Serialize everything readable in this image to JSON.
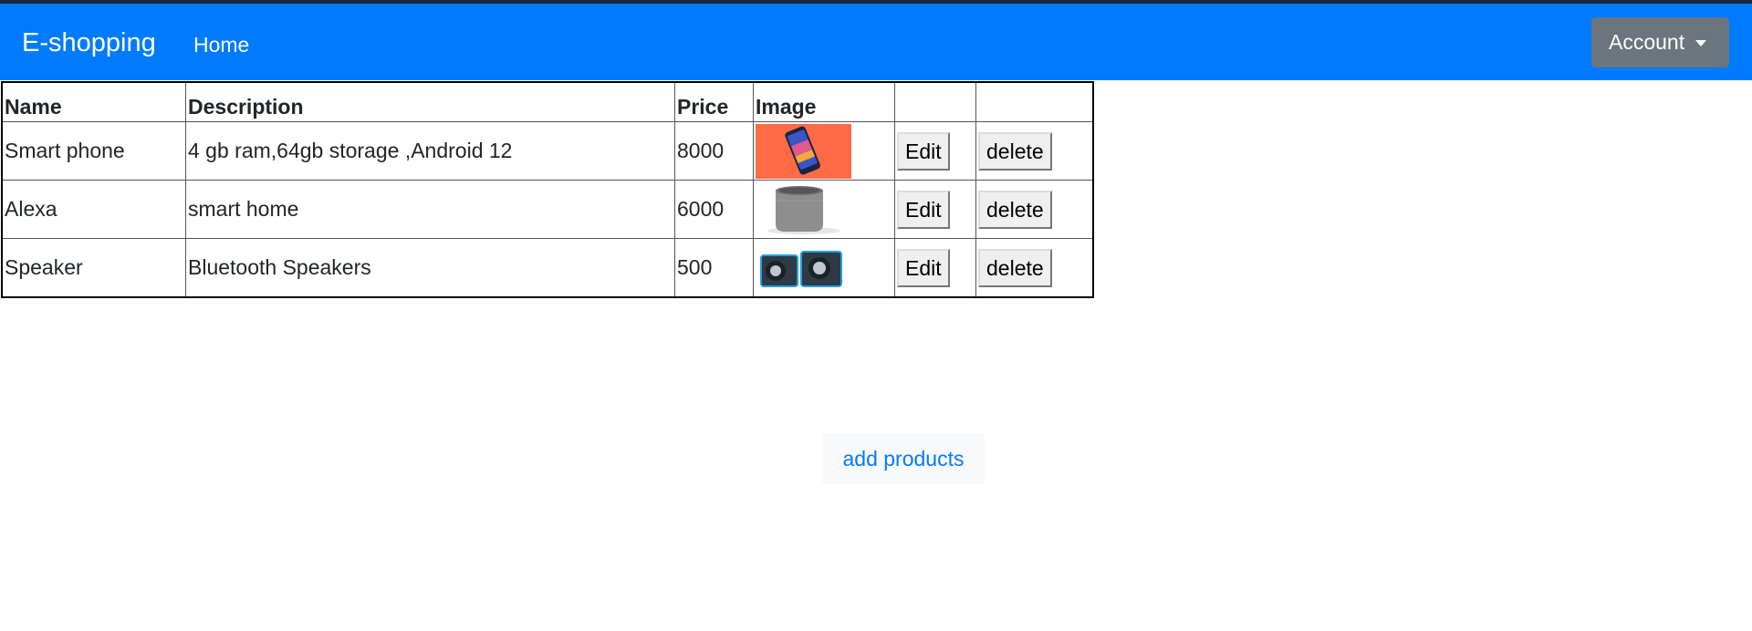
{
  "navbar": {
    "brand": "E-shopping",
    "home": "Home",
    "account": "Account",
    "bg_color": "#007bff",
    "account_color": "#6c757d"
  },
  "table": {
    "headers": [
      "Name",
      "Description",
      "Price",
      "Image",
      ""
    ],
    "rows": [
      {
        "name": "Smart phone",
        "description": "4 gb ram,64gb storage ,Android 12",
        "price": "8000",
        "image_icon": "smartphone-image",
        "edit": "Edit",
        "delete": "delete"
      },
      {
        "name": "Alexa",
        "description": "smart home",
        "price": "6000",
        "image_icon": "smart-speaker-image",
        "edit": "Edit",
        "delete": "delete"
      },
      {
        "name": "Speaker",
        "description": "Bluetooth Speakers",
        "price": "500",
        "image_icon": "bluetooth-speakers-image",
        "edit": "Edit",
        "delete": "delete"
      }
    ]
  },
  "add_products": "add products"
}
